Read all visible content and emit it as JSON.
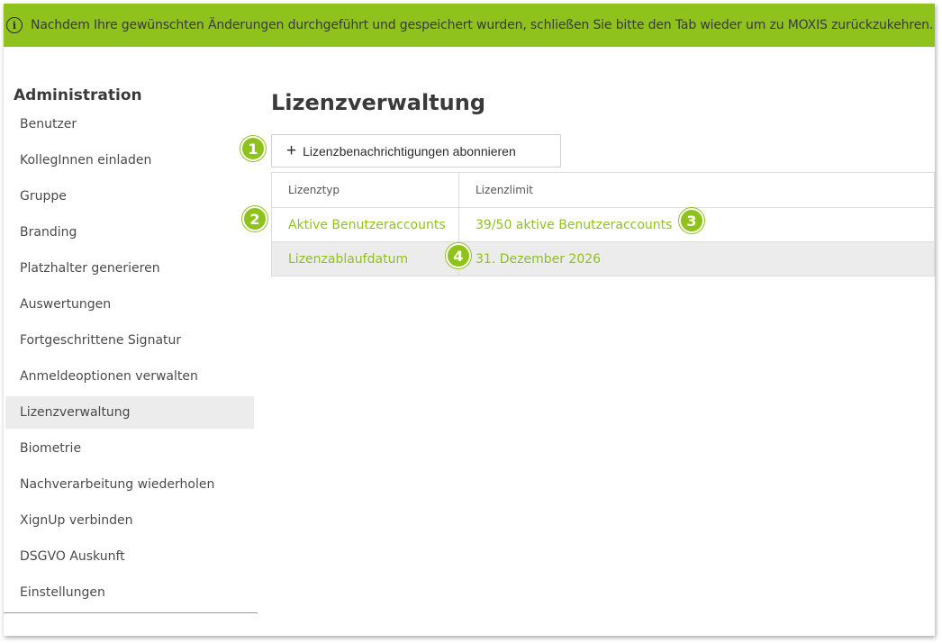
{
  "banner": {
    "icon": "info-icon",
    "text": "Nachdem Ihre gewünschten Änderungen durchgeführt und gespeichert wurden, schließen Sie bitte den Tab wieder um zu MOXIS zurückzukehren."
  },
  "sidebar": {
    "title": "Administration",
    "items": [
      {
        "label": "Benutzer"
      },
      {
        "label": "KollegInnen einladen"
      },
      {
        "label": "Gruppe"
      },
      {
        "label": "Branding"
      },
      {
        "label": "Platzhalter generieren"
      },
      {
        "label": "Auswertungen"
      },
      {
        "label": "Fortgeschrittene Signatur"
      },
      {
        "label": "Anmeldeoptionen verwalten"
      },
      {
        "label": "Lizenzverwaltung"
      },
      {
        "label": "Biometrie"
      },
      {
        "label": "Nachverarbeitung wiederholen"
      },
      {
        "label": "XignUp verbinden"
      },
      {
        "label": "DSGVO Auskunft"
      },
      {
        "label": "Einstellungen"
      }
    ],
    "active_item": "Lizenzverwaltung"
  },
  "main": {
    "title": "Lizenzverwaltung",
    "subscribe_button": {
      "icon": "plus-icon",
      "symbol": "+",
      "label": "Lizenzbenachrichtigungen abonnieren"
    },
    "table": {
      "headers": [
        "Lizenztyp",
        "Lizenzlimit"
      ],
      "rows": [
        [
          "Aktive Benutzeraccounts",
          "39/50 aktive Benutzeraccounts"
        ],
        [
          "Lizenzablaufdatum",
          "31. Dezember 2026"
        ]
      ]
    }
  },
  "markers": [
    "1",
    "2",
    "3",
    "4"
  ],
  "colors": {
    "accent": "#8fc21d",
    "active_bg": "#ececec"
  }
}
